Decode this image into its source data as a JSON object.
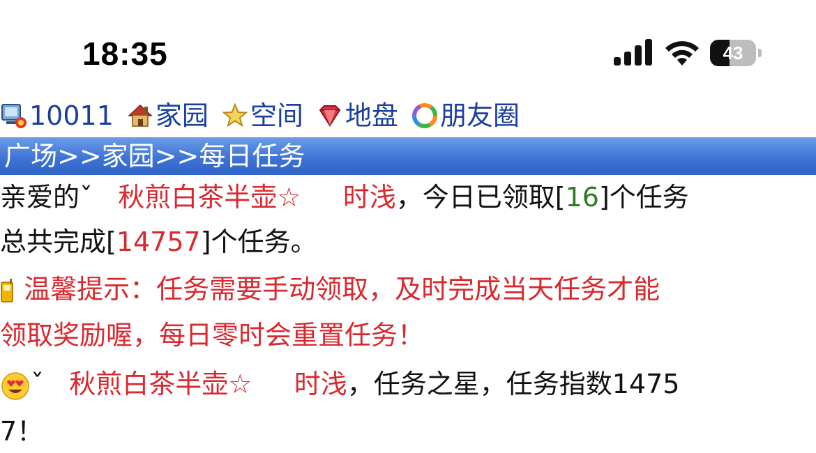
{
  "status_bar": {
    "time": "18:35",
    "battery_level": "43",
    "battery_fraction": 0.43,
    "icons": [
      "cellular-signal-icon",
      "wifi-icon",
      "battery-icon"
    ]
  },
  "nav": {
    "items": [
      {
        "label": "10011",
        "icon": "computer-icon"
      },
      {
        "label": "家园",
        "icon": "home-icon"
      },
      {
        "label": "空间",
        "icon": "star-icon"
      },
      {
        "label": "地盘",
        "icon": "gem-icon"
      },
      {
        "label": "朋友圈",
        "icon": "friends-circle-icon"
      }
    ]
  },
  "breadcrumb": {
    "text": "广场>>家园>>每日任务"
  },
  "content": {
    "greeting_prefix": "亲爱的",
    "greeting_mark": "ˇ",
    "username": "秋煎白茶半壶☆",
    "username_suffix": "时浅",
    "received_text_1": "，今日已领取[",
    "received_count": "16",
    "received_text_2": "]个任务",
    "total_text_1": "总共完成[",
    "total_count": "14757",
    "total_text_2": "]个任务。",
    "tip_line1": "温馨提示：任务需要手动领取，及时完成当天任务才能",
    "tip_line2": "领取奖励喔，每日零时会重置任务！",
    "star_mark": "ˇ",
    "star_username": "秋煎白茶半壶☆",
    "star_username_suffix": "时浅",
    "star_text": "，任务之星，任务指数1475",
    "star_text_wrap": "7！"
  },
  "colors": {
    "link_blue": "#1a3f9e",
    "highlight_red": "#d8292f",
    "count_green": "#2f7d22",
    "breadcrumb_bg": "#3f74d6"
  }
}
